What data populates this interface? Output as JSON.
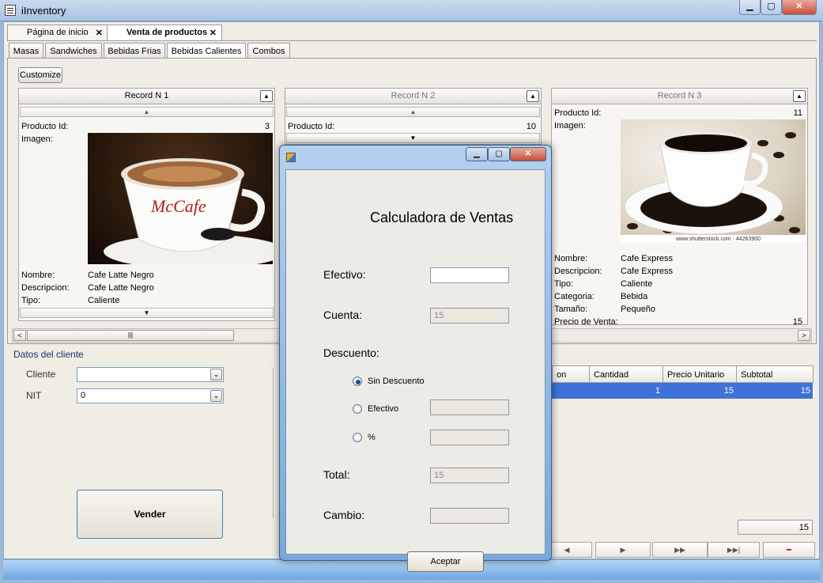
{
  "window": {
    "title": "iInventory",
    "min": "▁",
    "max": "▢",
    "close": "✕"
  },
  "doc_tabs": [
    {
      "label": "Página de inicio",
      "close": "✕"
    },
    {
      "label": "Venta de productos",
      "close": "✕"
    }
  ],
  "category_tabs": [
    "Masas",
    "Sandwiches",
    "Bebidas Frias",
    "Bebidas Calientes",
    "Combos"
  ],
  "customize_label": "Customize",
  "cards": [
    {
      "header": "Record N 1",
      "producto_id_label": "Producto Id:",
      "producto_id": "3",
      "imagen_label": "Imagen:",
      "nombre_label": "Nombre:",
      "nombre": "Cafe Latte Negro",
      "descripcion_label": "Descripcion:",
      "descripcion": "Cafe Latte Negro",
      "tipo_label": "Tipo:",
      "tipo": "Caliente",
      "cup_brand": "McCafe"
    },
    {
      "header": "Record N 2",
      "producto_id_label": "Producto Id:",
      "producto_id": "10"
    },
    {
      "header": "Record N 3",
      "producto_id_label": "Producto Id:",
      "producto_id": "11",
      "imagen_label": "Imagen:",
      "watermark": "shutterstock",
      "caption": "www.shutterstock.com · 44263900",
      "nombre_label": "Nombre:",
      "nombre": "Cafe Express",
      "descripcion_label": "Descripcion:",
      "descripcion": "Cafe Express",
      "tipo_label": "Tipo:",
      "tipo": "Caliente",
      "categoria_label": "Categoria:",
      "categoria": "Bebida",
      "tamano_label": "Tamaño:",
      "tamano": "Pequeño",
      "precio_label": "Precio de Venta:",
      "precio": "15"
    }
  ],
  "client": {
    "title": "Datos del cliente",
    "cliente_label": "Cliente",
    "cliente_value": "",
    "nit_label": "NIT",
    "nit_value": "0"
  },
  "vender_label": "Vender",
  "grid": {
    "columns": [
      "on",
      "Cantidad",
      "Precio Unitario",
      "Subtotal"
    ],
    "rows": [
      {
        "cantidad": "1",
        "precio_unitario": "15",
        "subtotal": "15"
      }
    ],
    "total": "15"
  },
  "nav": {
    "prev": "◀",
    "next": "▶",
    "next_page": "▶▶",
    "last": "▶▶|",
    "remove": "━"
  },
  "dialog": {
    "title": "Calculadora de Ventas",
    "efectivo_label": "Efectivo:",
    "efectivo_value": "",
    "cuenta_label": "Cuenta:",
    "cuenta_value": "15",
    "descuento_label": "Descuento:",
    "options": [
      "Sin Descuento",
      "Efectivo",
      "%"
    ],
    "selected_option": "Sin Descuento",
    "total_label": "Total:",
    "total_value": "15",
    "cambio_label": "Cambio:",
    "cambio_value": "",
    "aceptar_label": "Aceptar"
  }
}
